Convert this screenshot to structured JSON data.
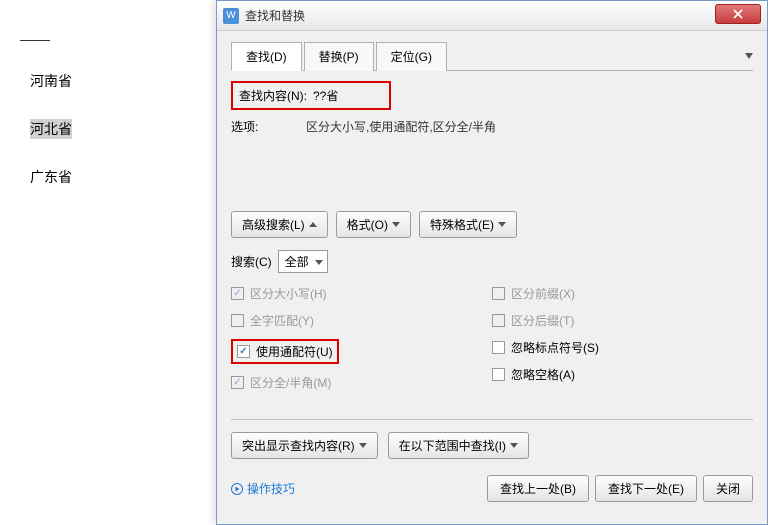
{
  "document": {
    "items": [
      "河南省",
      "河北省",
      "广东省"
    ],
    "highlighted_index": 1
  },
  "dialog": {
    "title": "查找和替换",
    "tabs": {
      "find": "查找(D)",
      "replace": "替换(P)",
      "goto": "定位(G)"
    },
    "find_label": "查找内容(N):",
    "find_value": "??省",
    "options_label": "选项:",
    "options_value": "区分大小写,使用通配符,区分全/半角",
    "buttons": {
      "advanced": "高级搜索(L)",
      "format": "格式(O)",
      "special": "特殊格式(E)"
    },
    "search_label": "搜索(C)",
    "search_value": "全部",
    "checks_left": {
      "case": "区分大小写(H)",
      "whole": "全字匹配(Y)",
      "wildcard": "使用通配符(U)",
      "width": "区分全/半角(M)"
    },
    "checks_right": {
      "prefix": "区分前缀(X)",
      "suffix": "区分后缀(T)",
      "punct": "忽略标点符号(S)",
      "space": "忽略空格(A)"
    },
    "footer1": {
      "highlight": "突出显示查找内容(R)",
      "in_range": "在以下范围中查找(I)"
    },
    "tips": "操作技巧",
    "footer_btns": {
      "prev": "查找上一处(B)",
      "next": "查找下一处(E)",
      "close": "关闭"
    }
  }
}
